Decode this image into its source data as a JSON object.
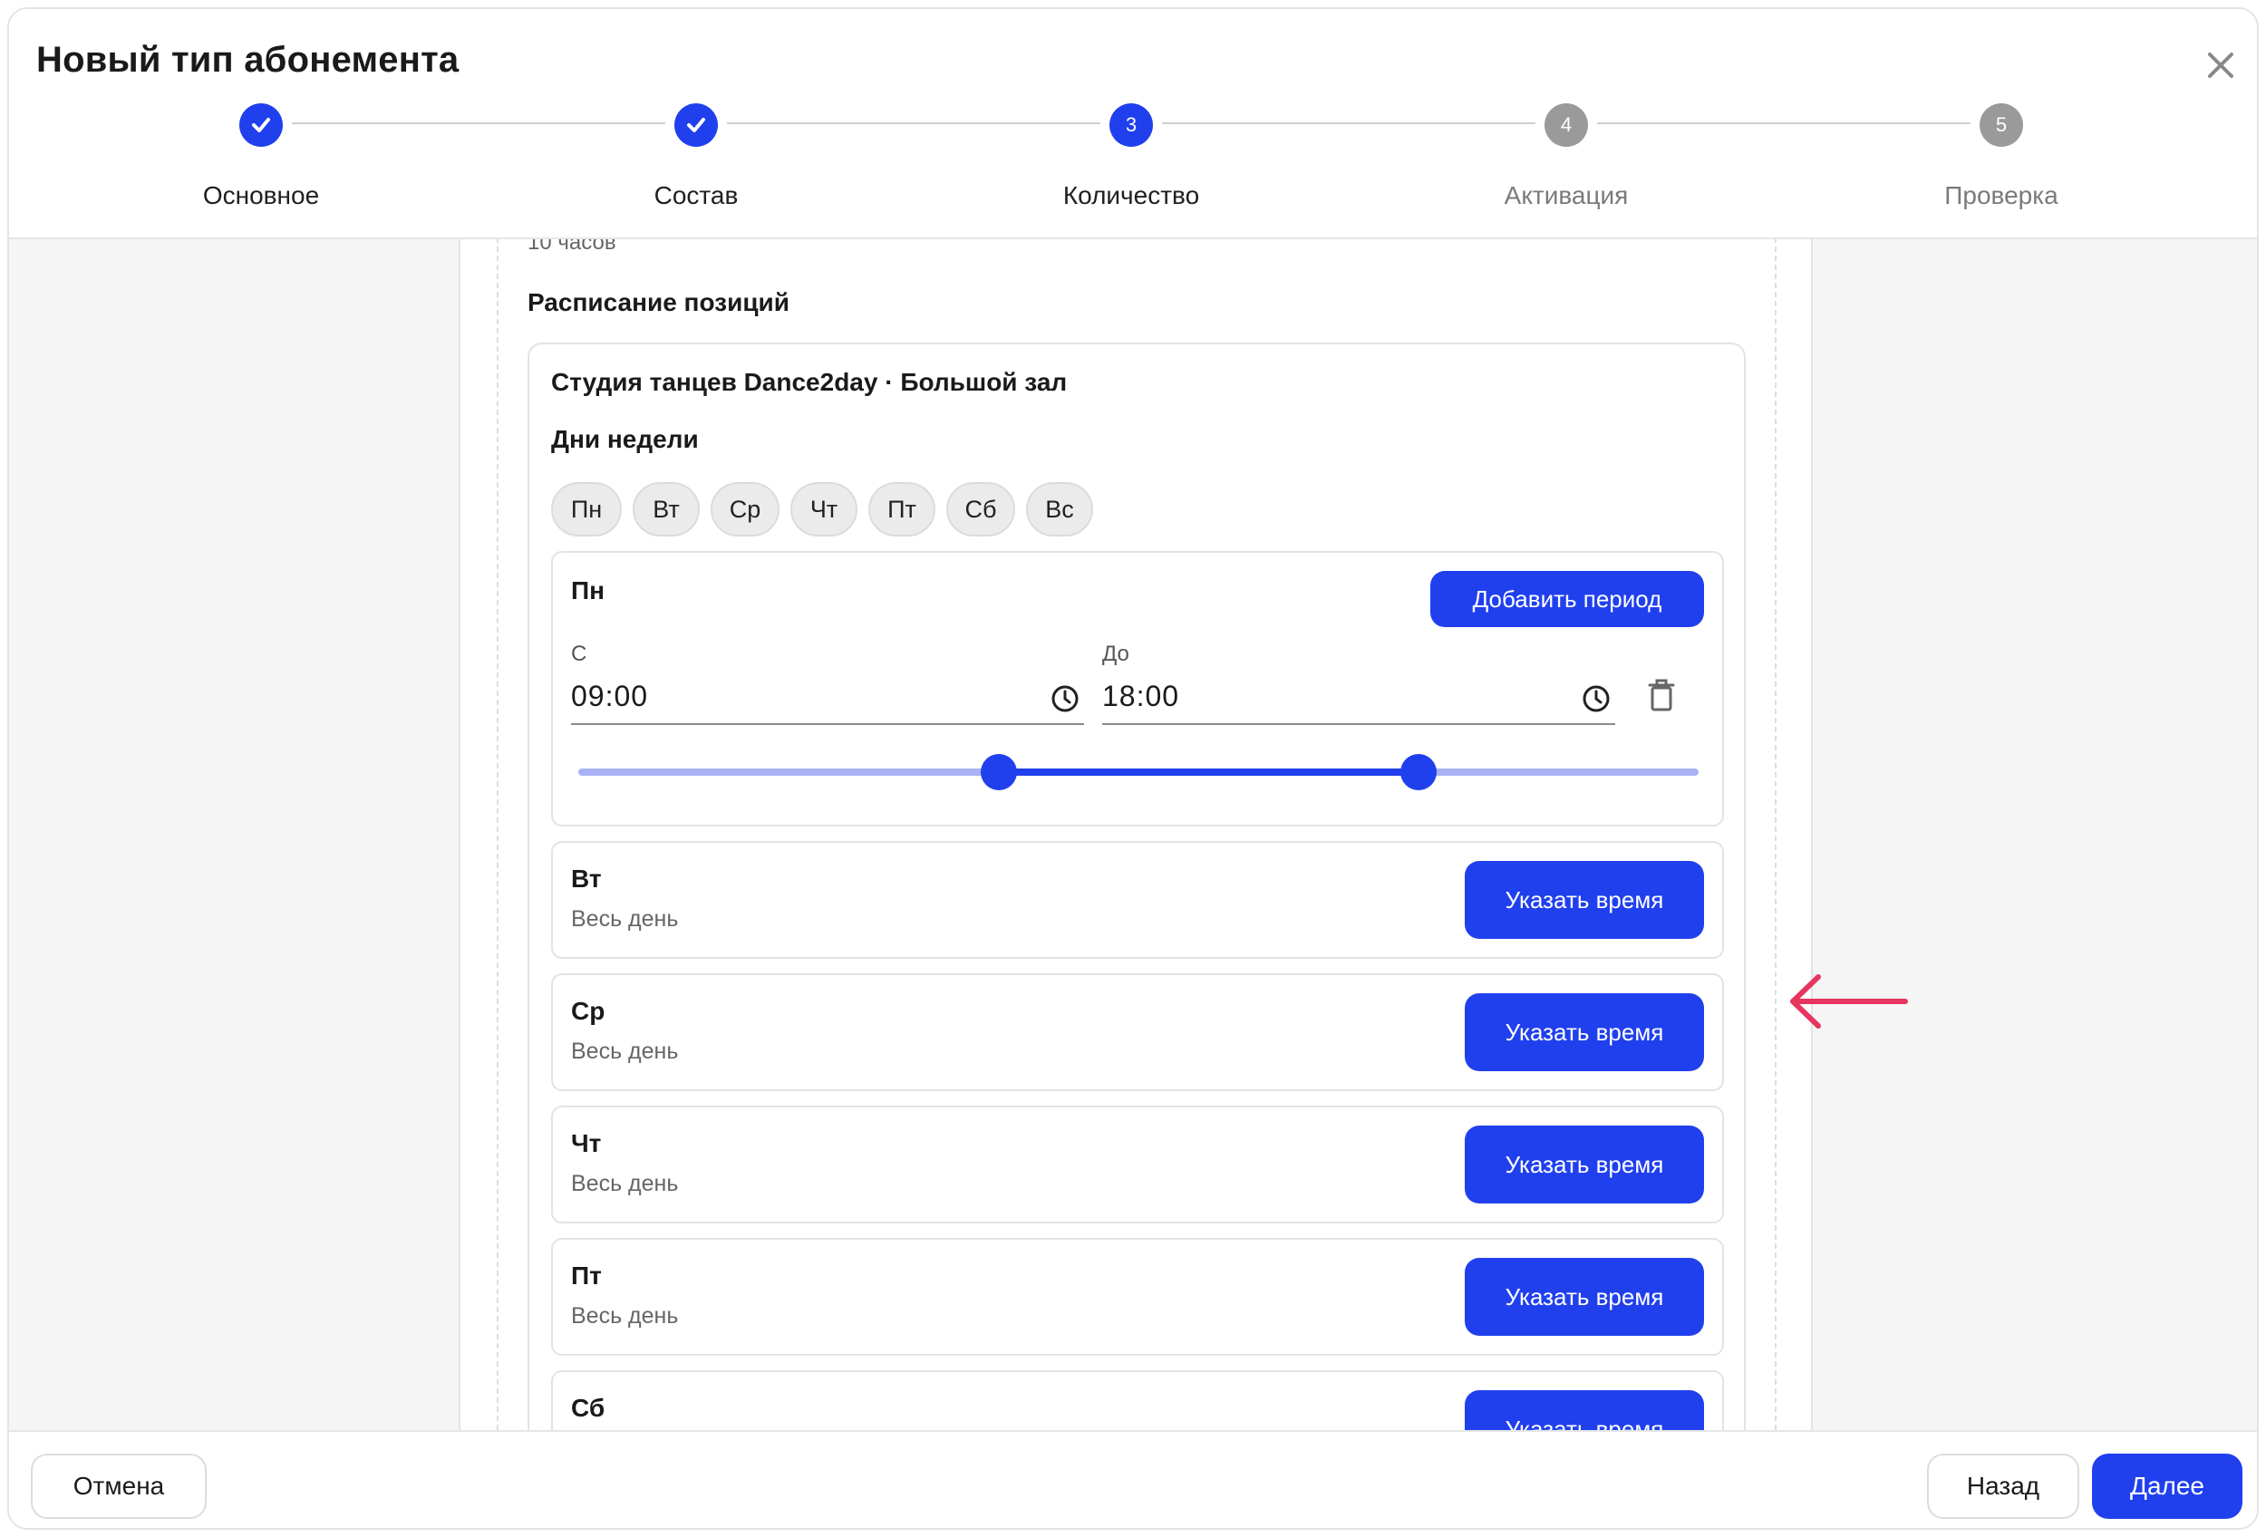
{
  "modal": {
    "title": "Новый тип абонемента"
  },
  "steps": [
    {
      "label": "Основное",
      "number": "1",
      "state": "done"
    },
    {
      "label": "Состав",
      "number": "2",
      "state": "done"
    },
    {
      "label": "Количество",
      "number": "3",
      "state": "active"
    },
    {
      "label": "Активация",
      "number": "4",
      "state": "todo"
    },
    {
      "label": "Проверка",
      "number": "5",
      "state": "todo"
    }
  ],
  "content": {
    "hours_text": "10 часов",
    "schedule_title": "Расписание позиций",
    "studio": {
      "title": "Студия танцев Dance2day · Большой зал",
      "days_title": "Дни недели",
      "day_chips": [
        "Пн",
        "Вт",
        "Ср",
        "Чт",
        "Пт",
        "Сб",
        "Вс"
      ],
      "monday": {
        "name": "Пн",
        "add_period_label": "Добавить период",
        "from_label": "С",
        "from_value": "09:00",
        "to_label": "До",
        "to_value": "18:00",
        "slider": {
          "min_hours": 0,
          "max_hours": 24,
          "from_hours": 9,
          "to_hours": 18
        }
      },
      "other_days": [
        {
          "name": "Вт",
          "sub": "Весь день",
          "button": "Указать время"
        },
        {
          "name": "Ср",
          "sub": "Весь день",
          "button": "Указать время"
        },
        {
          "name": "Чт",
          "sub": "Весь день",
          "button": "Указать время"
        },
        {
          "name": "Пт",
          "sub": "Весь день",
          "button": "Указать время"
        },
        {
          "name": "Сб",
          "sub": "",
          "button": "Указать время"
        }
      ]
    }
  },
  "footer": {
    "cancel_label": "Отмена",
    "back_label": "Назад",
    "next_label": "Далее"
  },
  "colors": {
    "accent": "#2040ee",
    "slider_track": "#a9b2f4",
    "annotation_arrow": "#e8355f",
    "step_inactive": "#9a9a9a"
  },
  "icons": {
    "close": "close-icon",
    "step_done": "check-icon",
    "time": "clock-icon",
    "delete": "trash-icon",
    "annotation": "arrow-left-icon"
  }
}
